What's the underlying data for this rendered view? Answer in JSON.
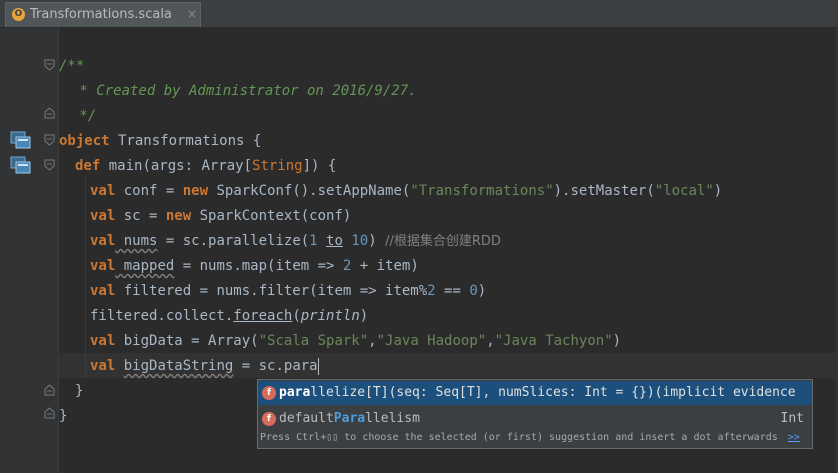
{
  "tab": {
    "icon": "scala-object-icon",
    "icon_glyph": "O",
    "label": "Transformations.scala",
    "close": "×"
  },
  "code": {
    "l1": "/**",
    "l2": " * Created by Administrator on 2016/9/27.",
    "l3": " */",
    "l4_kw": "object",
    "l4_name": " Transformations {",
    "l5_kw": "def",
    "l5_a": " main(args: Array[",
    "l5_b": "String",
    "l5_c": "]) {",
    "l6_kw": "val",
    "l6_a": " conf = ",
    "l6_new": "new",
    "l6_b": " SparkConf().setAppName(",
    "l6_s1": "\"Transformations\"",
    "l6_c": ").setMaster(",
    "l6_s2": "\"local\"",
    "l6_d": ")",
    "l7_kw": "val",
    "l7_a": " sc = ",
    "l7_new": "new",
    "l7_b": " SparkContext(conf)",
    "l8_kw": "val",
    "l8_a": " nums",
    "l8_b": " = sc.parallelize(",
    "l8_n1": "1",
    "l8_to": "to",
    "l8_n2": "10",
    "l8_c": ") ",
    "l8_cm": "//根据集合创建RDD",
    "l9_kw": "val",
    "l9_a": " mapped",
    "l9_b": " = nums.map(item => ",
    "l9_n": "2",
    "l9_c": " + item)",
    "l10_kw": "val",
    "l10_a": " filtered = nums.filter(item => item%",
    "l10_n1": "2",
    "l10_b": " == ",
    "l10_n2": "0",
    "l10_c": ")",
    "l11_a": "filtered.collect.",
    "l11_b": "foreach",
    "l11_c": "(",
    "l11_d": "println",
    "l11_e": ")",
    "l12_kw": "val",
    "l12_a": " bigData = Array(",
    "l12_s1": "\"Scala Spark\"",
    "l12_c1": ",",
    "l12_s2": "\"Java Hadoop\"",
    "l12_c2": ",",
    "l12_s3": "\"Java Tachyon\"",
    "l12_d": ")",
    "l13_kw": "val",
    "l13_a": " ",
    "l13_b": "bigDataString",
    "l13_c": " = sc.para",
    "l14": "}",
    "l15": "}"
  },
  "completion": {
    "item1": {
      "icon": "method-icon",
      "glyph": "f",
      "match": "para",
      "rest": "llelize[T](seq: Seq[T], numSlices: Int = {})(implicit evidence"
    },
    "item2": {
      "icon": "method-icon",
      "glyph": "f",
      "pre": "default",
      "match": "Para",
      "rest": "llelism",
      "type": "Int"
    },
    "hint": "Press Ctrl+▯▯ to choose the selected (or first) suggestion and insert a dot afterwards",
    "hint_link": ">>"
  },
  "colors": {
    "background": "#2b2b2b",
    "keyword": "#cc7832",
    "string": "#6a8759",
    "comment": "#629755",
    "number": "#6897bb",
    "selection": "#1c4f7c"
  }
}
